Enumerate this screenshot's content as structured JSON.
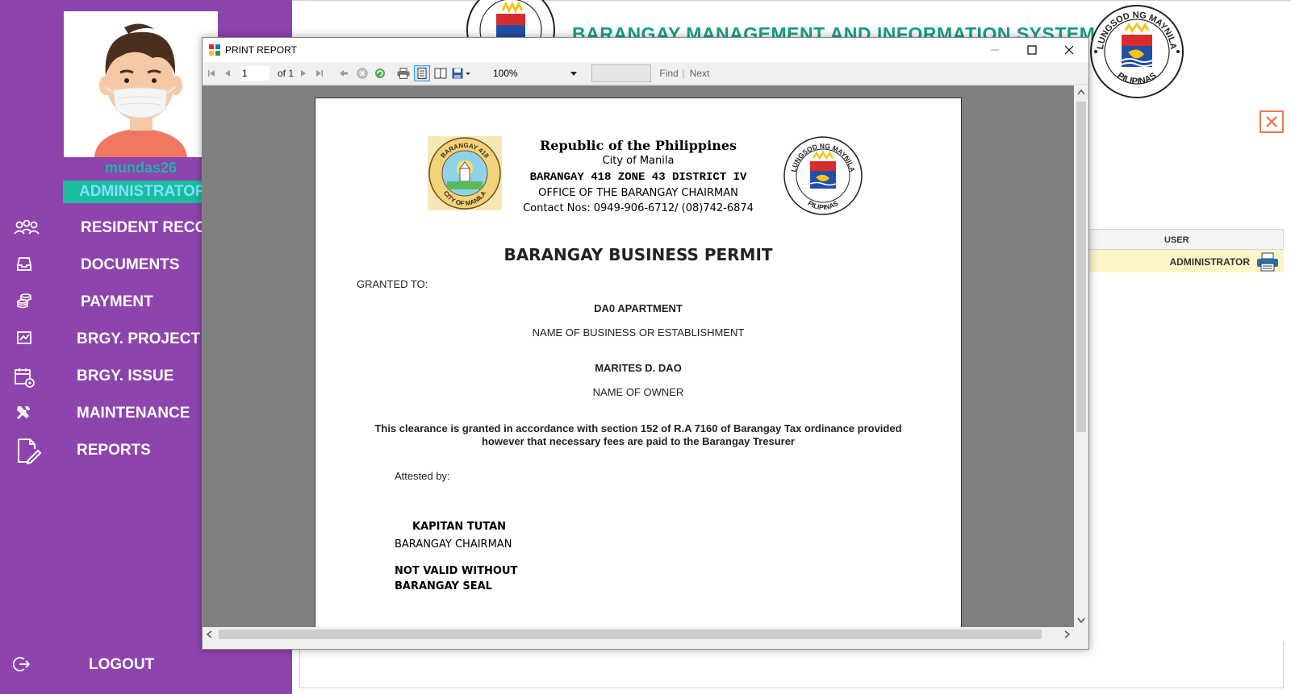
{
  "user": {
    "username": "mundas26",
    "role": "ADMINISTRATOR"
  },
  "nav": {
    "items": [
      {
        "label": "RESIDENT RECORDS",
        "icon": "residents-icon"
      },
      {
        "label": "DOCUMENTS",
        "icon": "inbox-icon"
      },
      {
        "label": "PAYMENT",
        "icon": "coins-icon"
      },
      {
        "label": "BRGY. PROJECT",
        "icon": "chart-icon"
      },
      {
        "label": "BRGY. ISSUE",
        "icon": "calendar-gear-icon"
      },
      {
        "label": "MAINTENANCE",
        "icon": "tools-icon"
      },
      {
        "label": "REPORTS",
        "icon": "edit-document-icon"
      }
    ],
    "logout_label": "LOGOUT"
  },
  "header": {
    "app_title": "BARANGAY MANAGEMENT AND INFORMATION SYSTEM",
    "seal_text_top": "LUNGSOD NG MAYNILA",
    "seal_text_bottom": "PILIPINAS"
  },
  "user_table": {
    "column": "USER",
    "row_value": "ADMINISTRATOR"
  },
  "dialog": {
    "title": "PRINT REPORT",
    "toolbar": {
      "page_current": "1",
      "page_of": "of 1",
      "zoom": "100%",
      "find_label": "Find",
      "separator": "|",
      "next_label": "Next"
    }
  },
  "report": {
    "republic": "Republic of the Philippines",
    "city": "City of Manila",
    "barangay": "BARANGAY 418 ZONE 43 DISTRICT IV",
    "office": "OFFICE OF THE BARANGAY CHAIRMAN",
    "contact": "Contact Nos: 0949-906-6712/ (08)742-6874",
    "brgy_seal_top": "BARANGAY 418",
    "brgy_seal_bottom": "CITY OF MANILA",
    "manila_seal_top": "LUNGSOD NG MAYNILA",
    "manila_seal_bottom": "PILIPINAS",
    "title": "BARANGAY BUSINESS PERMIT",
    "granted_to_label": "GRANTED TO:",
    "business_name": "DA0 APARTMENT",
    "business_caption": "NAME OF BUSINESS OR ESTABLISHMENT",
    "owner_name": "MARITES D. DAO",
    "owner_caption": "NAME OF OWNER",
    "clause_line1": "This clearance is granted in accordance with section 152 of R.A 7160 of Barangay Tax  ordinance provided",
    "clause_line2": "however that necessary fees are paid to the Barangay Tresurer",
    "attested_label": "Attested by:",
    "signatory_name": "KAPITAN TUTAN",
    "signatory_title": "BARANGAY CHAIRMAN",
    "notice_line1": "NOT VALID WITHOUT",
    "notice_line2": "BARANGAY SEAL"
  },
  "colors": {
    "sidebar": "#8e44ad",
    "accent": "#1abc9c",
    "title": "#16a085"
  }
}
